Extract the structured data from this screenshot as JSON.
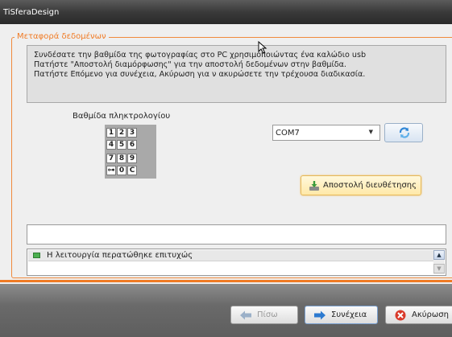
{
  "window": {
    "title": "TiSferaDesign"
  },
  "group": {
    "legend": "Μεταφορά δεδομένων"
  },
  "instructions": {
    "lines": [
      "Συνδέσατε την βαθμίδα της φωτογραφίας στο PC χρησιμοποιώντας ένα καλώδιο usb",
      "Πατήστε \"Αποστολή διαμόρφωσης\" για την αποστολή δεδομένων στην βαθμίδα.",
      "Πατήστε Επόμενο για συνέχεια, Ακύρωση για ν ακυρώσετε την τρέχουσα διαδικασία."
    ]
  },
  "keypad": {
    "label": "Βαθμίδα πληκτρολογίου",
    "keys": [
      "1",
      "2",
      "3",
      "4",
      "5",
      "6",
      "7",
      "8",
      "9",
      "⊶",
      "0",
      "C"
    ]
  },
  "port": {
    "selected": "COM7"
  },
  "send_button": {
    "label": "Αποστολή διευθέτησης"
  },
  "log": {
    "entries": [
      {
        "status": "success",
        "text": "Η λειτουργία περατώθηκε επιτυχώς"
      }
    ]
  },
  "footer": {
    "back_label": "Πίσω",
    "next_label": "Συνέχεια",
    "cancel_label": "Ακύρωση"
  },
  "icons": {
    "refresh": "refresh-icon",
    "send": "send-icon",
    "back": "back-arrow-icon",
    "next": "next-arrow-icon",
    "cancel": "cancel-icon",
    "success": "success-indicator-icon"
  },
  "colors": {
    "accent": "#f07b25",
    "success": "#4caf50"
  }
}
